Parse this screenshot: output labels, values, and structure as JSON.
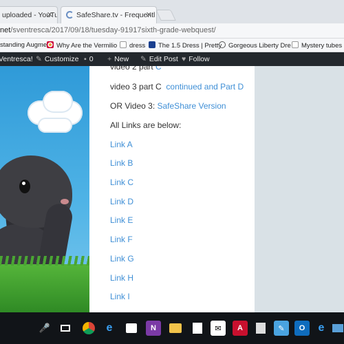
{
  "browser": {
    "tabs": [
      {
        "label": "uploaded - YouTu",
        "active": false
      },
      {
        "label": "SafeShare.tv - Frequentl",
        "active": true
      }
    ],
    "url_host": "net",
    "url_path": "/sventresca/2017/09/18/tuesday-91917sixth-grade-webquest/",
    "bookmarks": [
      {
        "label": "standing Augme",
        "icon": "page-icon"
      },
      {
        "label": "Why Are the Vermilio",
        "icon": "target-icon"
      },
      {
        "label": "dress",
        "icon": "file-icon"
      },
      {
        "label": "The 1.5 Dress | Pretty",
        "icon": "paypal-icon"
      },
      {
        "label": "Gorgeous Liberty Dre",
        "icon": "pinterest-icon"
      },
      {
        "label": "Mystery tubes les",
        "icon": "file-icon"
      }
    ]
  },
  "adminbar": {
    "site": "Ventresca!",
    "customize": "Customize",
    "comments": "0",
    "new": "New",
    "edit": "Edit Post",
    "follow": "Follow"
  },
  "content": {
    "partial_top_plain": "video 2 part ",
    "partial_top_link": "C",
    "line1_plain": "video 3 part C",
    "line1_link": "continued and Part D",
    "line2_plain": "OR Video 3:",
    "line2_link": "SafeShare Version",
    "line3": "All Links are below:",
    "links": [
      "Link A",
      "Link B",
      "Link C",
      "Link D",
      "Link E",
      "Link F",
      "Link G",
      "Link H",
      "Link I"
    ]
  },
  "colors": {
    "link": "#3f8fd6",
    "adminbar": "#23282d",
    "taskbar": "#111418"
  },
  "taskbar": {
    "icons": [
      "microphone-icon",
      "task-view-icon",
      "chrome-icon",
      "edge-icon",
      "store-icon",
      "onenote-icon",
      "file-explorer-icon",
      "acrobat-icon",
      "notes-icon",
      "outlook-icon",
      "ie-icon",
      "photos-icon"
    ]
  }
}
